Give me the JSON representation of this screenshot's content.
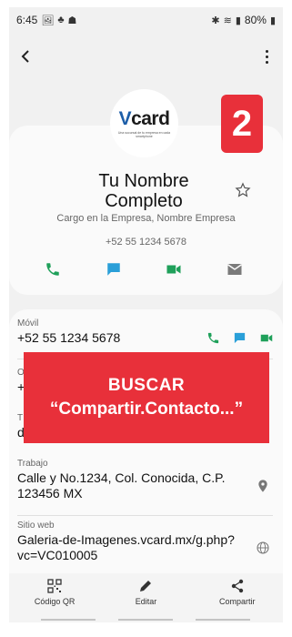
{
  "status_bar": {
    "time": "6:45",
    "left_icons": [
      "image-icon",
      "figure-icon",
      "android-icon"
    ],
    "right_icons": [
      "bluetooth-icon",
      "wifi-icon",
      "signal-icon"
    ],
    "battery": "80%"
  },
  "logo": {
    "word_v": "V",
    "word_rest": "card",
    "tagline": "Una sucursal de tu empresa en cada smartphone"
  },
  "badge": "2",
  "contact": {
    "name": "Tu Nombre Completo",
    "job": "Cargo en la Empresa, Nombre Empresa",
    "phone": "+52 55 1234 5678"
  },
  "fields": {
    "mobile_label": "Móvil",
    "mobile_value": "+52 55 1234 5678",
    "hidden_label_1": "O",
    "hidden_value_1": "+",
    "hidden_label_2": "T",
    "hidden_value_2": "d",
    "work_label": "Trabajo",
    "work_value": "Calle y No.1234, Col. Conocida,  C.P. 123456 MX",
    "site_label": "Sitio web",
    "site_value": "Galeria-de-Imagenes.vcard.mx/g.php?vc=VC010005"
  },
  "overlay": {
    "line1": "BUSCAR",
    "line2": "“Compartir.Contacto...”"
  },
  "bottom_nav": {
    "qr_label": "Código QR",
    "edit_label": "Editar",
    "share_label": "Compartir"
  },
  "colors": {
    "accent_red": "#e8303a",
    "call_green": "#1fa05a",
    "msg_blue": "#2a9fd8",
    "logo_blue": "#1d5ea8"
  }
}
